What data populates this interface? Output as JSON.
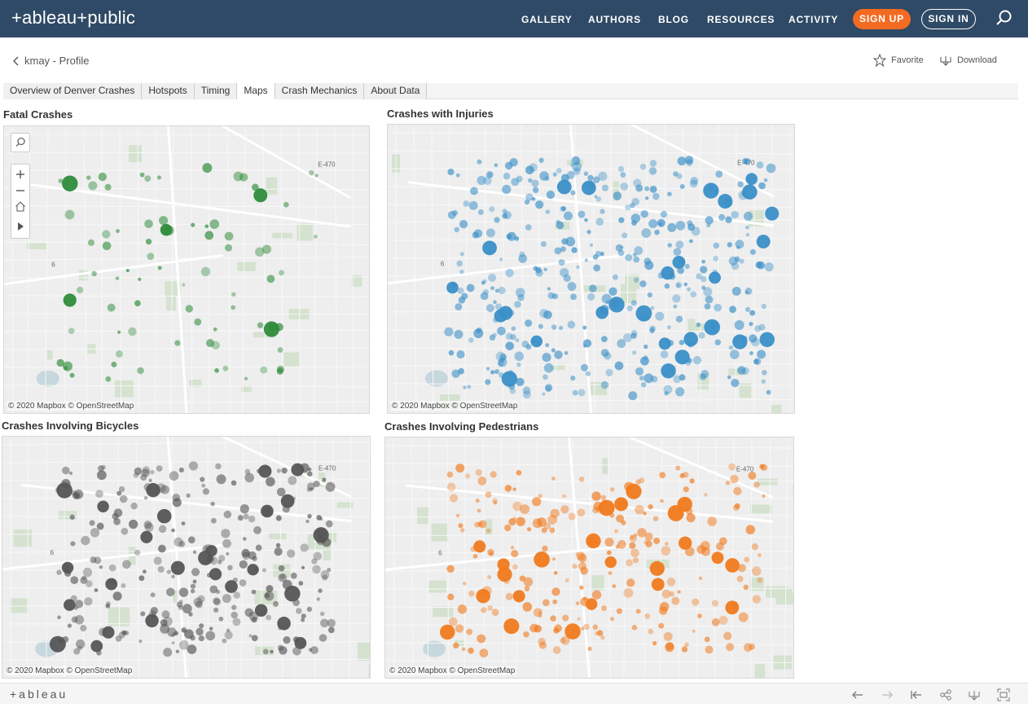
{
  "header": {
    "logo_text": "+ableau+public",
    "nav": [
      "GALLERY",
      "AUTHORS",
      "BLOG",
      "RESOURCES",
      "ACTIVITY"
    ],
    "signup_label": "SIGN UP",
    "signin_label": "SIGN IN",
    "search_icon": "search-icon"
  },
  "profile": {
    "back_label": "kmay - Profile",
    "favorite_label": "Favorite",
    "download_label": "Download"
  },
  "tabs": [
    "Overview of Denver Crashes",
    "Hotspots",
    "Timing",
    "Maps",
    "Crash Mechanics",
    "About Data"
  ],
  "active_tab": "Maps",
  "panels": {
    "fatal": {
      "title": "Fatal Crashes",
      "attribution": "© 2020 Mapbox © OpenStreetMap",
      "color": "#2e8b3a"
    },
    "injuries": {
      "title": "Crashes with Injuries",
      "attribution": "© 2020 Mapbox © OpenStreetMap",
      "color": "#3a8fc7"
    },
    "bicycles": {
      "title": "Crashes Involving Bicycles",
      "attribution": "© 2020 Mapbox © OpenStreetMap",
      "color": "#555555"
    },
    "pedestrians": {
      "title": "Crashes Involving Pedestrians",
      "attribution": "© 2020 Mapbox © OpenStreetMap",
      "color": "#f07a1e"
    }
  },
  "map_labels": {
    "highway": "E-470",
    "route": "6"
  },
  "footer": {
    "logo": "+ableau"
  },
  "colors": {
    "header_bg": "#2f4a66",
    "signup": "#f26b21"
  }
}
